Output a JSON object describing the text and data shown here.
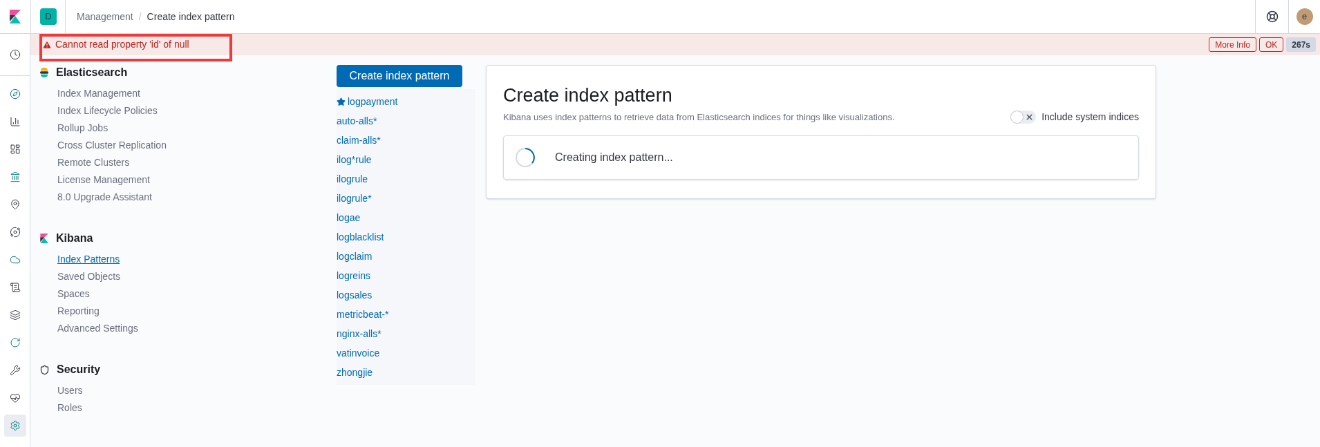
{
  "header": {
    "space": "D",
    "separator": "/",
    "breadcrumbs": [
      {
        "label": "Management",
        "current": false
      },
      {
        "label": "Create index pattern",
        "current": true
      }
    ],
    "user": "e"
  },
  "error_bar": {
    "message": "Cannot read property 'id' of null",
    "buttons": [
      "More Info",
      "OK"
    ],
    "timer": "267s"
  },
  "rail": [
    {
      "selected": false
    },
    {
      "selected": false
    },
    {
      "selected": false
    },
    {
      "selected": false
    },
    {
      "selected": false
    },
    {
      "selected": false
    },
    {
      "selected": false
    },
    {
      "selected": false
    },
    {
      "selected": false
    },
    {
      "selected": false
    },
    {
      "selected": false
    },
    {
      "selected": false
    },
    {
      "selected": false
    },
    {
      "selected": true
    }
  ],
  "sections": [
    {
      "title": "Elasticsearch",
      "items": [
        {
          "label": "Index Management",
          "selected": false
        },
        {
          "label": "Index Lifecycle Policies",
          "selected": false
        },
        {
          "label": "Rollup Jobs",
          "selected": false
        },
        {
          "label": "Cross Cluster Replication",
          "selected": false
        },
        {
          "label": "Remote Clusters",
          "selected": false
        },
        {
          "label": "License Management",
          "selected": false
        },
        {
          "label": "8.0 Upgrade Assistant",
          "selected": false
        }
      ]
    },
    {
      "title": "Kibana",
      "items": [
        {
          "label": "Index Patterns",
          "selected": true
        },
        {
          "label": "Saved Objects",
          "selected": false
        },
        {
          "label": "Spaces",
          "selected": false
        },
        {
          "label": "Reporting",
          "selected": false
        },
        {
          "label": "Advanced Settings",
          "selected": false
        }
      ]
    },
    {
      "title": "Security",
      "items": [
        {
          "label": "Users",
          "selected": false
        },
        {
          "label": "Roles",
          "selected": false
        }
      ]
    }
  ],
  "index_patterns": {
    "button": "Create index pattern",
    "items": [
      {
        "label": "logpayment",
        "starred": true
      },
      {
        "label": "auto-alls*",
        "starred": false
      },
      {
        "label": "claim-alls*",
        "starred": false
      },
      {
        "label": "ilog*rule",
        "starred": false
      },
      {
        "label": "ilogrule",
        "starred": false
      },
      {
        "label": "ilogrule*",
        "starred": false
      },
      {
        "label": "logae",
        "starred": false
      },
      {
        "label": "logblacklist",
        "starred": false
      },
      {
        "label": "logclaim",
        "starred": false
      },
      {
        "label": "logreins",
        "starred": false
      },
      {
        "label": "logsales",
        "starred": false
      },
      {
        "label": "metricbeat-*",
        "starred": false
      },
      {
        "label": "nginx-alls*",
        "starred": false
      },
      {
        "label": "vatinvoice",
        "starred": false
      },
      {
        "label": "zhongjie",
        "starred": false
      }
    ]
  },
  "panel": {
    "title": "Create index pattern",
    "description": "Kibana uses index patterns to retrieve data from Elasticsearch indices for things like visualizations.",
    "toggle": {
      "label": "Include system indices",
      "on": false
    },
    "status": "Creating index pattern..."
  }
}
